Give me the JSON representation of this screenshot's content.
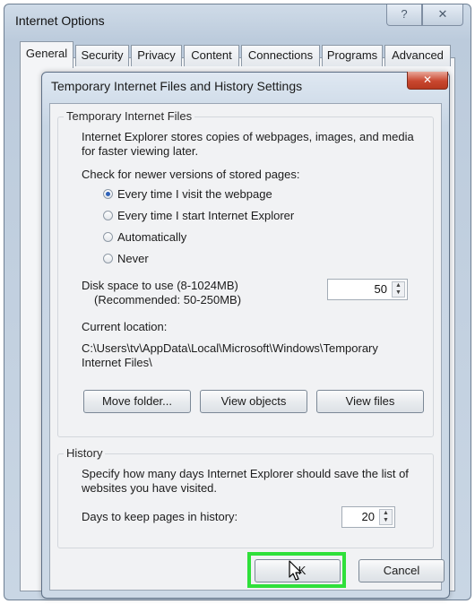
{
  "outer_window": {
    "title": "Internet Options",
    "help_glyph": "?",
    "close_glyph": "✕",
    "tabs": [
      {
        "label": "General"
      },
      {
        "label": "Security"
      },
      {
        "label": "Privacy"
      },
      {
        "label": "Content"
      },
      {
        "label": "Connections"
      },
      {
        "label": "Programs"
      },
      {
        "label": "Advanced"
      }
    ],
    "active_tab": "General"
  },
  "dialog": {
    "title": "Temporary Internet Files and History Settings",
    "close_glyph": "✕",
    "temp_files": {
      "group_title": "Temporary Internet Files",
      "description": "Internet Explorer stores copies of webpages, images, and media for faster viewing later.",
      "check_label": "Check for newer versions of stored pages:",
      "options": [
        {
          "label": "Every time I visit the webpage",
          "checked": true
        },
        {
          "label": "Every time I start Internet Explorer",
          "checked": false
        },
        {
          "label": "Automatically",
          "checked": false
        },
        {
          "label": "Never",
          "checked": false
        }
      ],
      "disk_label_line1": "Disk space to use (8-1024MB)",
      "disk_label_line2": "(Recommended: 50-250MB)",
      "disk_value": "50",
      "current_location_label": "Current location:",
      "current_location_path": "C:\\Users\\tv\\AppData\\Local\\Microsoft\\Windows\\Temporary Internet Files\\",
      "buttons": {
        "move_folder": "Move folder...",
        "view_objects": "View objects",
        "view_files": "View files"
      }
    },
    "history": {
      "group_title": "History",
      "description": "Specify how many days Internet Explorer should save the list of websites you have visited.",
      "days_label": "Days to keep pages in history:",
      "days_value": "20"
    },
    "footer": {
      "ok_label": "OK",
      "cancel_label": "Cancel"
    }
  },
  "colors": {
    "highlight": "#2fe03a",
    "close_red": "#c9472f",
    "radio_selected": "#2e62b9"
  }
}
